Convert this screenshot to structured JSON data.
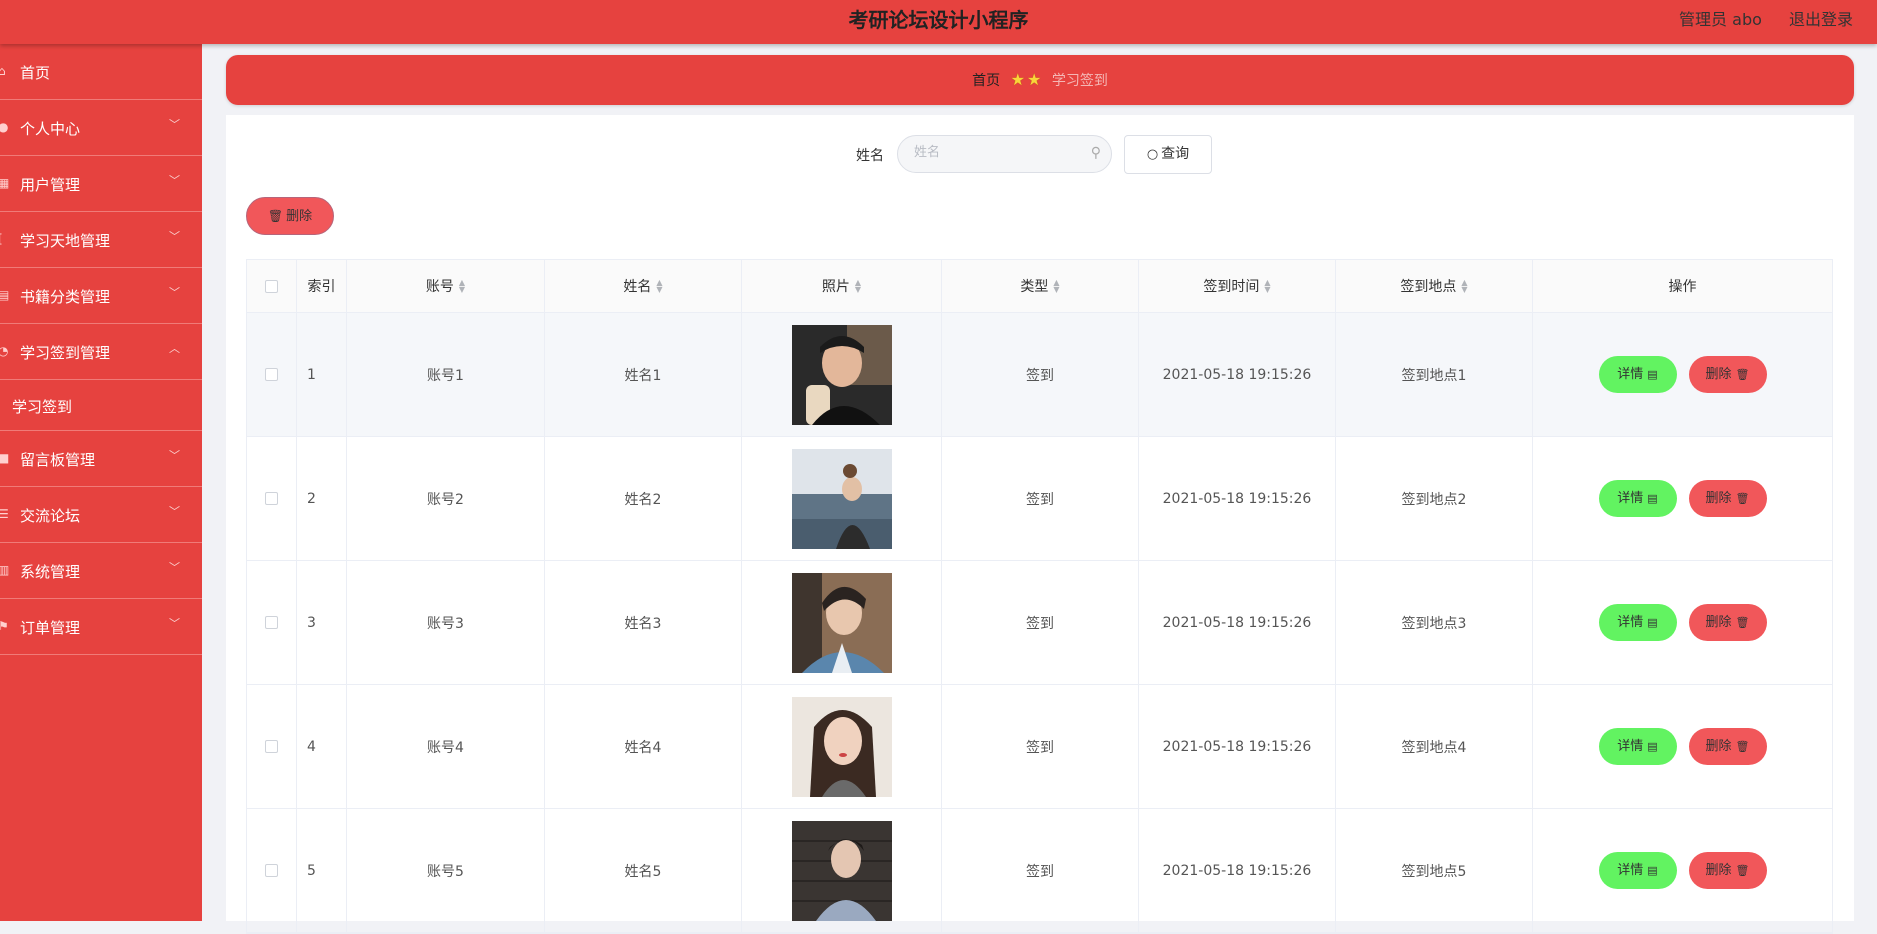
{
  "header": {
    "title": "考研论坛设计小程序",
    "user_label": "管理员 abo",
    "logout_label": "退出登录"
  },
  "sidebar": {
    "items": [
      {
        "label": "首页",
        "icon": "home-icon",
        "has_arrow": false
      },
      {
        "label": "个人中心",
        "icon": "user-icon",
        "has_arrow": true
      },
      {
        "label": "用户管理",
        "icon": "grid-icon",
        "has_arrow": true
      },
      {
        "label": "学习天地管理",
        "icon": "bracket-icon",
        "has_arrow": true
      },
      {
        "label": "书籍分类管理",
        "icon": "book-icon",
        "has_arrow": true
      },
      {
        "label": "学习签到管理",
        "icon": "clock-icon",
        "has_arrow": true,
        "expanded": true
      },
      {
        "label": "留言板管理",
        "icon": "message-icon",
        "has_arrow": true
      },
      {
        "label": "交流论坛",
        "icon": "sliders-icon",
        "has_arrow": true
      },
      {
        "label": "系统管理",
        "icon": "chart-icon",
        "has_arrow": true
      },
      {
        "label": "订单管理",
        "icon": "flag-icon",
        "has_arrow": true
      }
    ],
    "subitem": "学习签到"
  },
  "breadcrumb": {
    "home": "首页",
    "current": "学习签到"
  },
  "search": {
    "label": "姓名",
    "placeholder": "姓名",
    "value": "",
    "button_label": "查询"
  },
  "toolbar": {
    "batch_delete_label": "删除"
  },
  "table": {
    "columns": [
      "索引",
      "账号",
      "姓名",
      "照片",
      "类型",
      "签到时间",
      "签到地点",
      "操作"
    ],
    "rows": [
      {
        "index": "1",
        "account": "账号1",
        "name": "姓名1",
        "type": "签到",
        "time": "2021-05-18 19:15:26",
        "place": "签到地点1"
      },
      {
        "index": "2",
        "account": "账号2",
        "name": "姓名2",
        "type": "签到",
        "time": "2021-05-18 19:15:26",
        "place": "签到地点2"
      },
      {
        "index": "3",
        "account": "账号3",
        "name": "姓名3",
        "type": "签到",
        "time": "2021-05-18 19:15:26",
        "place": "签到地点3"
      },
      {
        "index": "4",
        "account": "账号4",
        "name": "姓名4",
        "type": "签到",
        "time": "2021-05-18 19:15:26",
        "place": "签到地点4"
      },
      {
        "index": "5",
        "account": "账号5",
        "name": "姓名5",
        "type": "签到",
        "time": "2021-05-18 19:15:26",
        "place": "签到地点5"
      }
    ],
    "detail_label": "详情",
    "delete_label": "删除"
  },
  "colors": {
    "primary_red": "#e6423f",
    "detail_green": "#62f361",
    "delete_red": "#f1575a",
    "star_yellow": "#f9d53a"
  }
}
